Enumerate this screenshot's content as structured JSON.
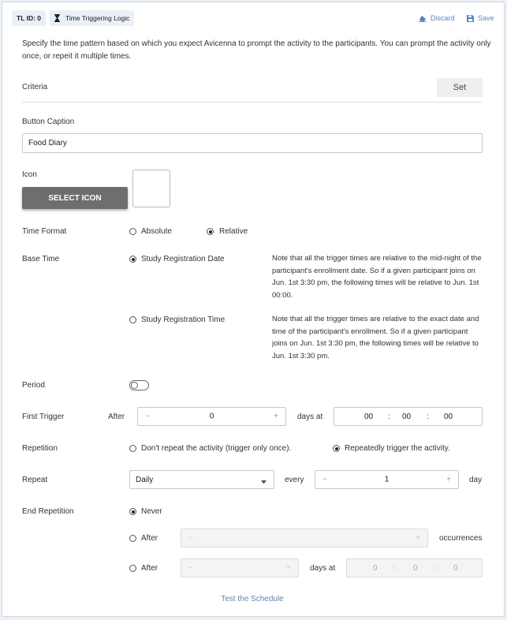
{
  "header": {
    "tl_id": "TL ID: 0",
    "title": "Time Triggering Logic",
    "discard": "Discard",
    "save": "Save"
  },
  "description": "Specify the time pattern based on which you expect Avicenna to prompt the activity to the participants. You can prompt the activity only once, or repeit it multiple times.",
  "criteria": {
    "label": "Criteria",
    "set_button": "Set"
  },
  "button_caption": {
    "label": "Button Caption",
    "value": "Food Diary"
  },
  "icon": {
    "label": "Icon",
    "select_button": "SELECT ICON"
  },
  "time_format": {
    "label": "Time Format",
    "options": [
      "Absolute",
      "Relative"
    ],
    "selected": "Relative"
  },
  "base_time": {
    "label": "Base Time",
    "options": [
      {
        "label": "Study Registration Date",
        "selected": true,
        "note": "Note that all the trigger times are relative to the mid-night of the participant's enrollment date. So if a given participant joins on Jun. 1st 3:30 pm, the following times will be relative to Jun. 1st 00:00."
      },
      {
        "label": "Study Registration Time",
        "selected": false,
        "note": "Note that all the trigger times are relative to the exact date and time of the participant's enrollment. So if a given participant joins on Jun. 1st 3:30 pm, the following times will be relative to Jun. 1st 3:30 pm."
      }
    ]
  },
  "period": {
    "label": "Period",
    "on": false
  },
  "first_trigger": {
    "label": "First Trigger",
    "after": "After",
    "minus": "−",
    "plus": "+",
    "value": "0",
    "days_at": "days at",
    "hh": "00",
    "mm": "00",
    "ss": "00",
    "sep": ":"
  },
  "repetition": {
    "label": "Repetition",
    "options": [
      "Don't repeat the activity (trigger only once).",
      "Repeatedly trigger the activity."
    ],
    "selected": 1
  },
  "repeat": {
    "label": "Repeat",
    "select_value": "Daily",
    "every": "every",
    "value": "1",
    "unit": "day",
    "minus": "−",
    "plus": "+"
  },
  "end_repetition": {
    "label": "End Repetition",
    "never": "Never",
    "after1": "After",
    "occurrences": "occurrences",
    "after2": "After",
    "days_at": "days at",
    "hh": "0",
    "mm": "0",
    "ss": "0",
    "sep": ":",
    "minus": "−",
    "plus": "+",
    "selected": "Never"
  },
  "test_link": "Test the Schedule",
  "colors": {
    "accent": "#5b86b8",
    "dark_button": "#6e6e6e",
    "border": "#c8d9ec"
  },
  "icons": [
    "hourglass-icon",
    "eraser-icon",
    "floppy-disk-icon",
    "caret-down-icon"
  ]
}
